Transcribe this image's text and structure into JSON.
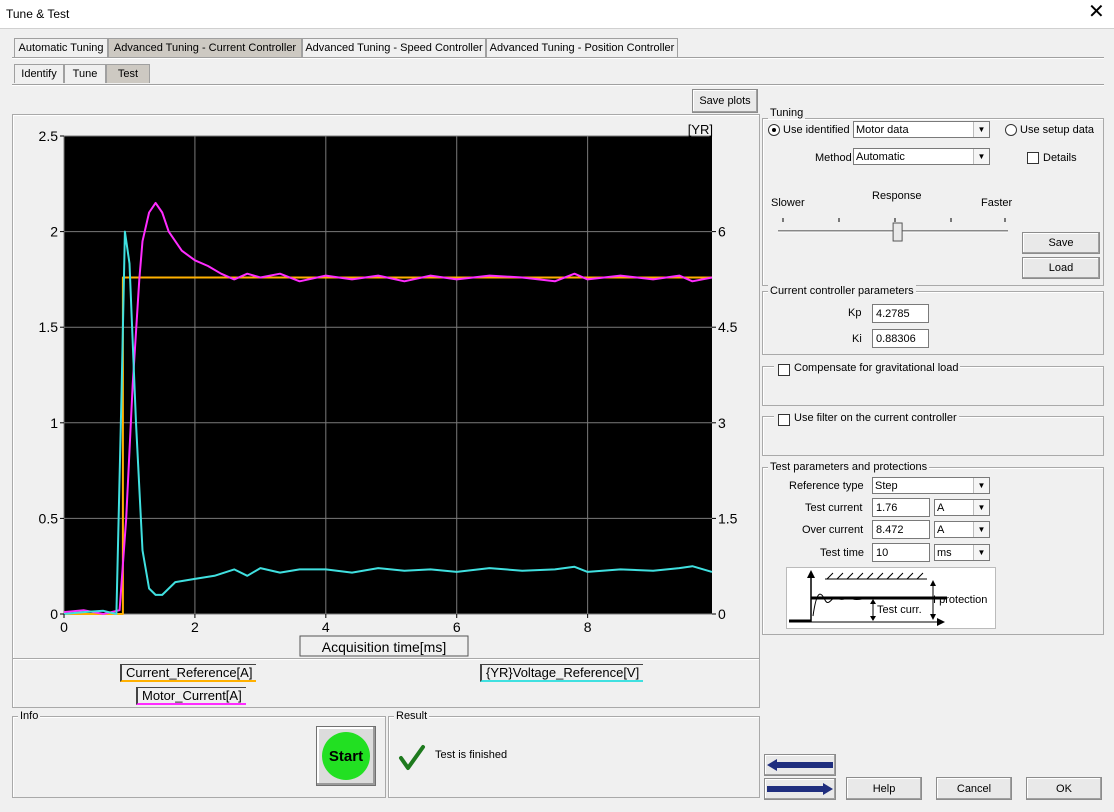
{
  "window": {
    "title": "Tune & Test"
  },
  "main_tabs": [
    "Automatic Tuning",
    "Advanced Tuning - Current Controller",
    "Advanced Tuning - Speed Controller",
    "Advanced Tuning - Position Controller"
  ],
  "sub_tabs": [
    "Identify",
    "Tune",
    "Test"
  ],
  "save_plots_label": "Save plots",
  "chart_data": {
    "type": "line",
    "xlabel": "Acquisition time[ms]",
    "right_axis_label": "[YR]",
    "xlim": [
      0,
      9.9
    ],
    "ylim": [
      0,
      2.5
    ],
    "y2lim": [
      0,
      7.5
    ],
    "x_ticks": [
      "0",
      "2",
      "4",
      "6",
      "8"
    ],
    "y_ticks": [
      "0",
      "0.5",
      "1",
      "1.5",
      "2",
      "2.5"
    ],
    "y2_ticks": [
      "0",
      "1.5",
      "3",
      "4.5",
      "6"
    ],
    "background": "#000000",
    "grid": true,
    "series": [
      {
        "name": "Current_Reference[A]",
        "axis": "left",
        "color": "#ffb000",
        "x": [
          0,
          0.9,
          0.9,
          9.9
        ],
        "values": [
          0,
          0,
          1.76,
          1.76
        ]
      },
      {
        "name": "Motor_Current[A]",
        "axis": "left",
        "color": "#ff2cff",
        "x": [
          0,
          0.3,
          0.6,
          0.85,
          0.95,
          1.05,
          1.15,
          1.2,
          1.3,
          1.4,
          1.5,
          1.6,
          1.8,
          2.0,
          2.2,
          2.4,
          2.6,
          2.8,
          3.0,
          3.3,
          3.6,
          4.0,
          4.4,
          4.8,
          5.2,
          5.6,
          6.0,
          6.5,
          7.0,
          7.5,
          7.8,
          8.0,
          8.5,
          9.0,
          9.4,
          9.6,
          9.9
        ],
        "values": [
          0.01,
          0.02,
          0.0,
          0.02,
          0.5,
          1.2,
          1.75,
          1.95,
          2.1,
          2.15,
          2.1,
          2.0,
          1.9,
          1.85,
          1.82,
          1.78,
          1.75,
          1.78,
          1.76,
          1.78,
          1.74,
          1.77,
          1.75,
          1.77,
          1.74,
          1.77,
          1.75,
          1.77,
          1.76,
          1.74,
          1.78,
          1.75,
          1.77,
          1.75,
          1.77,
          1.74,
          1.76
        ]
      },
      {
        "name": "{YR}Voltage_Reference[V]",
        "axis": "right",
        "color": "#40e0e0",
        "x": [
          0,
          0.3,
          0.6,
          0.8,
          0.88,
          0.93,
          1.0,
          1.1,
          1.2,
          1.3,
          1.4,
          1.5,
          1.7,
          2.0,
          2.3,
          2.6,
          2.8,
          3.0,
          3.3,
          3.6,
          4.0,
          4.4,
          4.8,
          5.2,
          5.6,
          6.0,
          6.5,
          7.0,
          7.5,
          7.8,
          8.0,
          8.5,
          9.0,
          9.4,
          9.6,
          9.9
        ],
        "values": [
          0.0,
          0.03,
          0.05,
          0.0,
          3.5,
          6.0,
          5.5,
          3.0,
          1.0,
          0.4,
          0.3,
          0.3,
          0.5,
          0.55,
          0.6,
          0.7,
          0.6,
          0.72,
          0.65,
          0.7,
          0.7,
          0.65,
          0.72,
          0.68,
          0.7,
          0.66,
          0.72,
          0.68,
          0.7,
          0.74,
          0.66,
          0.7,
          0.68,
          0.72,
          0.75,
          0.66
        ]
      }
    ]
  },
  "legend": [
    "Current_Reference[A]",
    "Motor_Current[A]",
    "{YR}Voltage_Reference[V]"
  ],
  "tuning": {
    "title": "Tuning",
    "use_identified_label": "Use identified",
    "use_identified_value": "Motor data",
    "use_setup_label": "Use setup data",
    "method_label": "Method",
    "method_value": "Automatic",
    "details_label": "Details",
    "response_label": "Response",
    "slower_label": "Slower",
    "faster_label": "Faster",
    "response_level": 0.52,
    "save_label": "Save",
    "load_label": "Load"
  },
  "ccp": {
    "title": "Current controller parameters",
    "kp_label": "Kp",
    "kp_value": "4.2785",
    "ki_label": "Ki",
    "ki_value": "0.88306"
  },
  "grav": {
    "label": "Compensate for gravitational load"
  },
  "filter": {
    "label": "Use filter on the current controller"
  },
  "test_params": {
    "title": "Test parameters and protections",
    "ref_type_label": "Reference type",
    "ref_type_value": "Step",
    "test_current_label": "Test current",
    "test_current_value": "1.76",
    "test_current_unit": "A",
    "over_current_label": "Over current",
    "over_current_value": "8.472",
    "over_current_unit": "A",
    "test_time_label": "Test time",
    "test_time_value": "10",
    "test_time_unit": "ms",
    "diagram_protection_label": "I protection",
    "diagram_test_label": "Test curr."
  },
  "info": {
    "title": "Info",
    "start_label": "Start"
  },
  "result": {
    "title": "Result",
    "status": "Test is finished"
  },
  "buttons": {
    "help": "Help",
    "cancel": "Cancel",
    "ok": "OK"
  }
}
